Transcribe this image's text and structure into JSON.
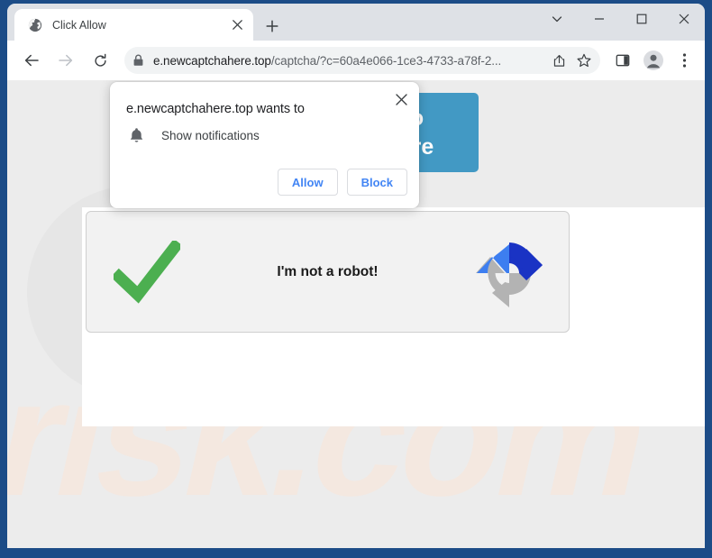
{
  "window": {
    "controls": {
      "tab_search": "tab-search-chevron",
      "minimize": "minimize",
      "maximize": "maximize",
      "close": "close"
    }
  },
  "tab_strip": {
    "tab": {
      "title": "Click Allow",
      "favicon": "globe-icon",
      "close_label": "×"
    },
    "new_tab_label": "+"
  },
  "toolbar": {
    "back": "back-arrow",
    "forward": "forward-arrow",
    "reload": "reload-icon",
    "url_host": "e.newcaptchahere.top",
    "url_path": "/captcha/?c=60a4e066-1ce3-4733-a78f-2...",
    "url_full": "e.newcaptchahere.top/captcha/?c=60a4e066-1ce3-4733-a78f-2...",
    "lock_icon": "lock-icon",
    "share": "share-icon",
    "bookmark": "star-icon",
    "side_panel": "side-panel-icon",
    "profile": "profile-avatar-icon",
    "menu": "three-dot-menu-icon"
  },
  "permission_dialog": {
    "title": "e.newcaptchahere.top wants to",
    "permission_icon": "bell-icon",
    "permission_label": "Show notifications",
    "allow_label": "Allow",
    "block_label": "Block",
    "close_label": "×"
  },
  "page": {
    "cta_button": {
      "line1": "o",
      "line2": "are"
    },
    "captcha": {
      "label": "I'm not a robot!",
      "check_icon": "green-checkmark-icon",
      "refresh_icon": "refresh-arrows-icon"
    },
    "watermark": "risk.com"
  },
  "colors": {
    "frame_blue": "#1c4c87",
    "chrome_bg": "#dee1e6",
    "omnibox_bg": "#f1f3f4",
    "viewport_bg": "#ececec",
    "cta_blue": "#4299c4",
    "check_green": "#4caf50",
    "refresh_blue_light": "#3d7ef0",
    "refresh_blue_dark": "#1a33c4",
    "refresh_grey": "#b0b0b0",
    "dialog_link_blue": "#4285f4",
    "watermark_tint": "#f7ece6"
  }
}
